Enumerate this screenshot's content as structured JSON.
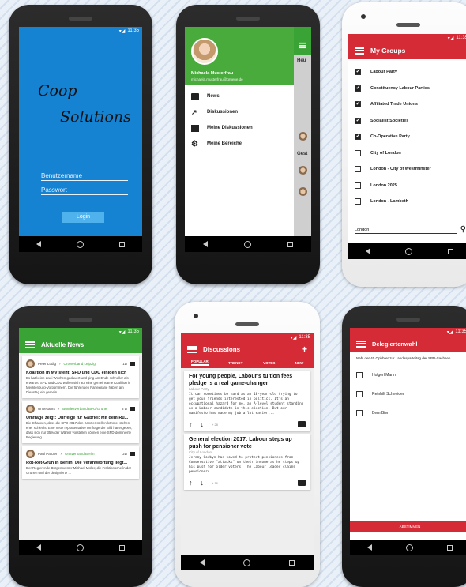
{
  "status_time": "11:35",
  "login": {
    "logo_line1": "Coop",
    "logo_line2": "Solutions",
    "username_placeholder": "Benutzername",
    "password_placeholder": "Passwort",
    "login_button": "Login"
  },
  "drawer": {
    "user_name": "Michaela Musterfrau",
    "user_email": "michaela.musterfrau@gruene.de",
    "items": [
      "News",
      "Diskussionen",
      "Meine Diskussionen",
      "Meine Bereiche"
    ],
    "peek_text_1": "Heu",
    "peek_text_2": "Gest"
  },
  "groups": {
    "title": "My Groups",
    "items": [
      {
        "label": "Labour Party",
        "checked": true
      },
      {
        "label": "Constituency Labour Parties",
        "checked": true
      },
      {
        "label": "Affiliated Trade Unions",
        "checked": true
      },
      {
        "label": "Socialist Societies",
        "checked": true
      },
      {
        "label": "Co-Operative Party",
        "checked": true
      },
      {
        "label": "City of London",
        "checked": false
      },
      {
        "label": "London - City of Westminster",
        "checked": false
      },
      {
        "label": "London 2025",
        "checked": false
      },
      {
        "label": "London - Lambeth",
        "checked": false
      }
    ],
    "search_value": "London"
  },
  "news": {
    "title": "Aktuelle News",
    "cards": [
      {
        "author": "Peter Ludig",
        "source": "Ortsverband Leipzig",
        "time": "1w",
        "headline": "Koalition in MV steht: SPD und CDU einigen sich",
        "body": "Es hat keine zwei Wochen gedauert und ging am Ende schneller als erwartet: SPD und CDU wollen sich auf eine gemeinsame Koalition in Mecklenburg-Vorpommern. Die führenden Parteigrane haben am Dienstag ein gemein..."
      },
      {
        "author": "Unbekannt",
        "source": "Bundesverband BPG/Grüne",
        "time": "3 w",
        "headline": "Umfrage zeigt: Ohrfeige für Gabriel: Mit dem Rü...",
        "body": "Die Chancen, dass die SPD 2017 den Kanzler stellen könnte, stehen eher schlecht. Eine neue repräsentative Umfrage der Bild hat ergeben, dass sich nur 35% der Wähler vorstellen können eine SPD-dominierte Regierung ..."
      },
      {
        "author": "Paul Panzer",
        "source": "Ortsverband Berlin",
        "time": "2w",
        "headline": "Rot-Rot-Grün in Berlin: Die Verantwortung liegt...",
        "body": "Der Regierende Bürgermeister Michael Müller, die Fraktionschefin der Grünen und der designierte ..."
      }
    ]
  },
  "discussions": {
    "title": "Discussions",
    "tabs": [
      "POPULAR",
      "TRENDY",
      "VOTES",
      "NEW"
    ],
    "posts": [
      {
        "title": "For young people, Labour's tuition fees pledge is a real game-changer",
        "group": "Labour Party",
        "body": "It can sometimes be hard as an 18-year-old trying to get your friends interested in politics. It's an occupational hazard for me, an A-level student standing as a Labour candidate in this election. But our manifesto has made my job a lot easier...",
        "count": "+ 28"
      },
      {
        "title": "General election 2017: Labour steps up push for pensioner vote",
        "group": "City of London",
        "body": "Jeremy Corbyn has vowed to protect pensioners from Conservative \"attacks\" on their income as he steps up his push for older voters. The Labour leader claims pensioners ...",
        "count": "+ 16"
      }
    ]
  },
  "vote": {
    "title": "Delegiertenwahl",
    "instruction": "Nahl der 40 Ophbrer zur Landesparteitag der SPD-Sachsen",
    "options": [
      "Holgerl Mann",
      "Reinhilt Schneider",
      "Bern Bien"
    ],
    "submit": "ABSTIMMEN"
  },
  "colors": {
    "login_blue": "#1583d2",
    "green": "#3aa335",
    "red": "#d42b36"
  }
}
